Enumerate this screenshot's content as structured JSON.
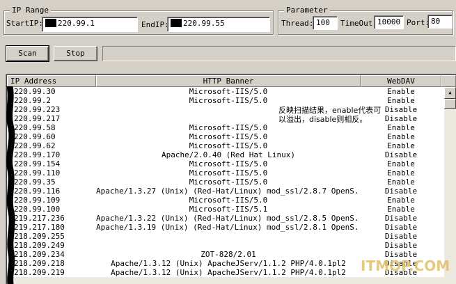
{
  "ip_range": {
    "title": "IP Range",
    "start_label": "StartIP:",
    "start_value": "220.99.1",
    "end_label": "EndIP:",
    "end_value": "220.99.55"
  },
  "parameter": {
    "title": "Parameter",
    "thread_label": "Thread:",
    "thread_value": "100",
    "timeout_label": "TimeOut:",
    "timeout_value": "10000",
    "port_label": "Port:",
    "port_value": "80"
  },
  "buttons": {
    "scan": "Scan",
    "stop": "Stop"
  },
  "table": {
    "columns": [
      "IP Address",
      "HTTP Banner",
      "WebDAV"
    ],
    "rows": [
      [
        "220.99.30",
        "Microsoft-IIS/5.0",
        "Enable"
      ],
      [
        "220.99.2",
        "Microsoft-IIS/5.0",
        "Enable"
      ],
      [
        "220.99.223",
        "",
        "Disable"
      ],
      [
        "220.99.217",
        "",
        "Disable"
      ],
      [
        "220.99.58",
        "Microsoft-IIS/5.0",
        "Enable"
      ],
      [
        "220.99.60",
        "Microsoft-IIS/5.0",
        "Enable"
      ],
      [
        "220.99.62",
        "Microsoft-IIS/5.0",
        "Enable"
      ],
      [
        "220.99.170",
        "Apache/2.0.40 (Red Hat Linux)",
        "Disable"
      ],
      [
        "220.99.154",
        "Microsoft-IIS/5.0",
        "Enable"
      ],
      [
        "220.99.110",
        "Microsoft-IIS/5.0",
        "Enable"
      ],
      [
        "220.99.35",
        "Microsoft-IIS/5.0",
        "Enable"
      ],
      [
        "220.99.116",
        "Apache/1.3.27 (Unix)  (Red-Hat/Linux) mod_ssl/2.8.7 OpenS...",
        "Disable"
      ],
      [
        "220.99.109",
        "Microsoft-IIS/5.0",
        "Enable"
      ],
      [
        "220.99.100",
        "Microsoft-IIS/5.1",
        "Enable"
      ],
      [
        "219.217.236",
        "Apache/1.3.22 (Unix)  (Red-Hat/Linux) mod_ssl/2.8.5 OpenS...",
        "Disable"
      ],
      [
        "219.217.180",
        "Apache/1.3.19 (Unix)  (Red-Hat/Linux) mod_ssl/2.8.1 OpenS...",
        "Disable"
      ],
      [
        "218.209.255",
        "",
        "Disable"
      ],
      [
        "218.209.249",
        "",
        "Disable"
      ],
      [
        "218.209.234",
        "ZOT-828/2.01",
        "Disable"
      ],
      [
        "218.209.218",
        "Apache/1.3.12 (Unix) ApacheJServ/1.1.2 PHP/4.0.1pl2",
        "Disable"
      ],
      [
        "218.209.219",
        "Apache/1.3.12 (Unix) ApacheJServ/1.1.2 PHP/4.0.1pl2",
        "Disable"
      ]
    ]
  },
  "annotation": "反映扫描结果，enable代表可以溢出，disable则相反。",
  "watermark": "ITMOP.COM",
  "colors": {
    "window_bg": "#d4d0c8",
    "list_bg": "#ffffff",
    "redaction": "#000000",
    "watermark": "#e0c16a"
  },
  "icons": {
    "scroll_up": "arrow-up-icon",
    "scroll_down": "arrow-down-icon"
  }
}
